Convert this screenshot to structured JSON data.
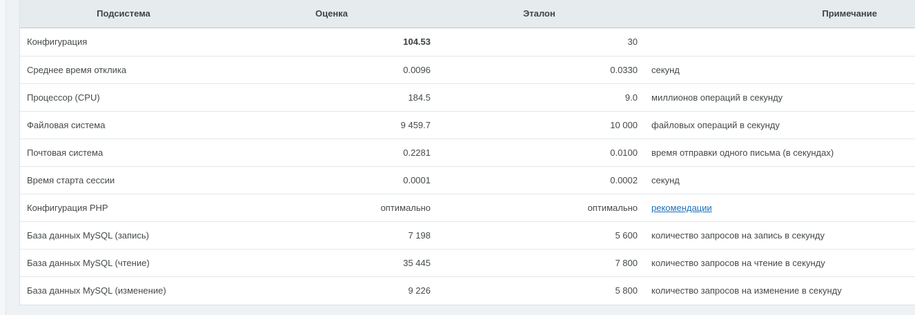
{
  "table": {
    "headers": {
      "subsystem": "Подсистема",
      "score": "Оценка",
      "reference": "Эталон",
      "note": "Примечание"
    },
    "rows": [
      {
        "name": "Конфигурация",
        "score": "104.53",
        "reference": "30",
        "note": "",
        "emphasis": true
      },
      {
        "name": "Среднее время отклика",
        "score": "0.0096",
        "reference": "0.0330",
        "note": "секунд"
      },
      {
        "name": "Процессор (CPU)",
        "score": "184.5",
        "reference": "9.0",
        "note": "миллионов операций в секунду"
      },
      {
        "name": "Файловая система",
        "score": "9 459.7",
        "reference": "10 000",
        "note": "файловых операций в секунду"
      },
      {
        "name": "Почтовая система",
        "score": "0.2281",
        "reference": "0.0100",
        "note": "время отправки одного письма (в секундах)"
      },
      {
        "name": "Время старта сессии",
        "score": "0.0001",
        "reference": "0.0002",
        "note": "секунд"
      },
      {
        "name": "Конфигурация PHP",
        "score": "оптимально",
        "reference": "оптимально",
        "note": "рекомендации",
        "note_is_link": true
      },
      {
        "name": "База данных MySQL (запись)",
        "score": "7 198",
        "reference": "5 600",
        "note": "количество запросов на запись в секунду"
      },
      {
        "name": "База данных MySQL (чтение)",
        "score": "35 445",
        "reference": "7 800",
        "note": "количество запросов на чтение в секунду"
      },
      {
        "name": "База данных MySQL (изменение)",
        "score": "9 226",
        "reference": "5 800",
        "note": "количество запросов на изменение в секунду"
      }
    ]
  },
  "colors": {
    "header_bg": "#e6ecee",
    "link": "#1d6fb8",
    "row_border": "#e2e7e9"
  }
}
